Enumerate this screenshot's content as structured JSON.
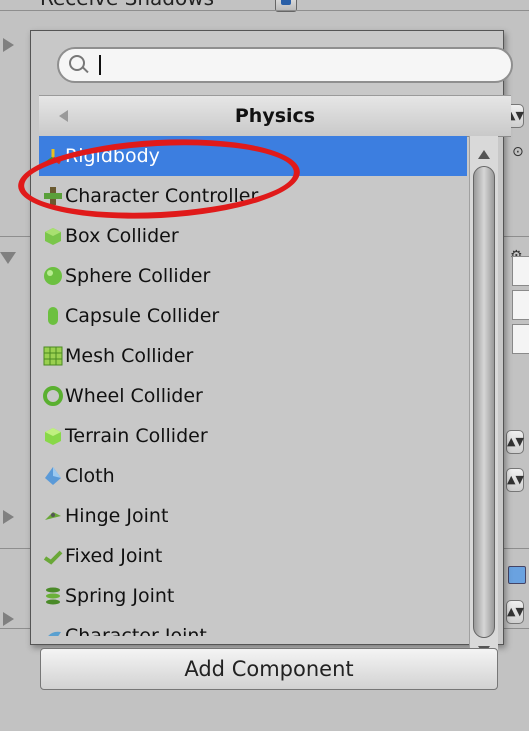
{
  "background": {
    "top_label": "Receive Shadows",
    "right_spinners": [
      "▲▼",
      "▲▼",
      "▲▼",
      "▲▼"
    ]
  },
  "popup": {
    "search": {
      "value": "",
      "placeholder": ""
    },
    "category_title": "Physics",
    "items": [
      {
        "label": "Rigidbody",
        "icon": "rigidbody-icon",
        "selected": true
      },
      {
        "label": "Character Controller",
        "icon": "character-controller-icon"
      },
      {
        "label": "Box Collider",
        "icon": "box-collider-icon"
      },
      {
        "label": "Sphere Collider",
        "icon": "sphere-collider-icon"
      },
      {
        "label": "Capsule Collider",
        "icon": "capsule-collider-icon"
      },
      {
        "label": "Mesh Collider",
        "icon": "mesh-collider-icon"
      },
      {
        "label": "Wheel Collider",
        "icon": "wheel-collider-icon"
      },
      {
        "label": "Terrain Collider",
        "icon": "terrain-collider-icon"
      },
      {
        "label": "Cloth",
        "icon": "cloth-icon"
      },
      {
        "label": "Hinge Joint",
        "icon": "hinge-joint-icon"
      },
      {
        "label": "Fixed Joint",
        "icon": "fixed-joint-icon"
      },
      {
        "label": "Spring Joint",
        "icon": "spring-joint-icon"
      },
      {
        "label": "Character Joint",
        "icon": "character-joint-icon"
      }
    ]
  },
  "add_component_label": "Add Component",
  "colors": {
    "selection": "#3c7ee0",
    "highlight_ring": "#e01a1a"
  }
}
